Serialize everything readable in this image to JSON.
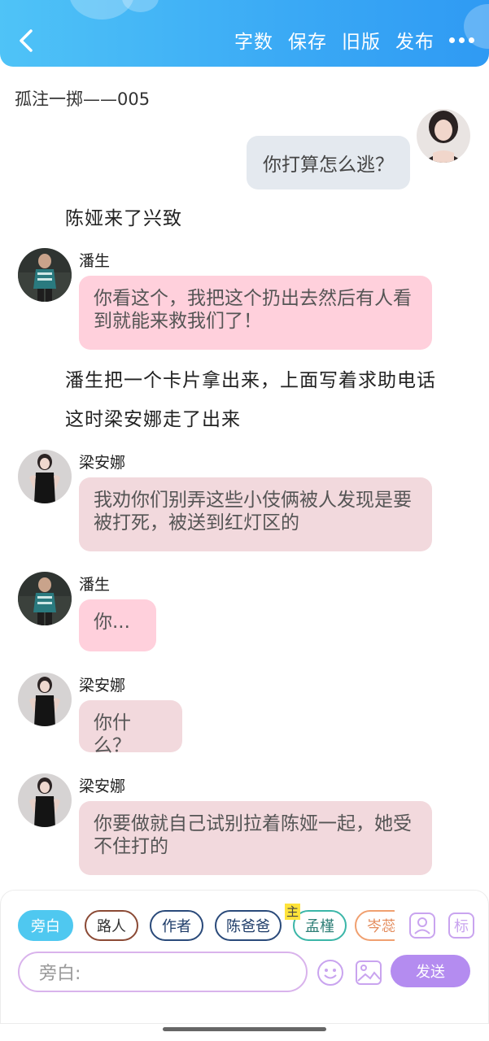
{
  "header": {
    "word_count_label": "字数",
    "save_label": "保存",
    "old_version_label": "旧版",
    "publish_label": "发布"
  },
  "story_title": "孤注一掷——005",
  "my_message": "你打算怎么逃？",
  "messages": [
    {
      "type": "narration",
      "text": "陈娅来了兴致"
    },
    {
      "type": "character",
      "speaker": "潘生",
      "text": "你看这个，我把这个扔出去然后有人看到就能来救我们了！"
    },
    {
      "type": "narration",
      "text": "潘生把一个卡片拿出来，上面写着求助电话"
    },
    {
      "type": "narration",
      "text": "这时梁安娜走了出来"
    },
    {
      "type": "character",
      "speaker": "梁安娜",
      "text": "我劝你们别弄这些小伎俩被人发现是要被打死，被送到红灯区的"
    },
    {
      "type": "character",
      "speaker": "潘生",
      "text": "你..."
    },
    {
      "type": "character",
      "speaker": "梁安娜",
      "text": "你什么？"
    },
    {
      "type": "character",
      "speaker": "梁安娜",
      "text": "你要做就自己试别拉着陈娅一起，她受不住打的"
    }
  ],
  "role_chips": [
    "旁白",
    "路人",
    "作者",
    "陈爸爸",
    "孟槿",
    "岑蕊"
  ],
  "main_badge": "主",
  "tool_icons": {
    "person": "person-card-icon",
    "mark": "mark-icon",
    "emoji": "emoji-icon",
    "image": "image-icon"
  },
  "mark_label": "标",
  "input": {
    "placeholder": "旁白:"
  },
  "send_label": "发送",
  "colors": {
    "header_start": "#4fc3f7",
    "header_end": "#2f9af3",
    "pink_bubble": "#ffd0dc",
    "rose_bubble": "#f2d9dd",
    "my_bubble": "#e4e9ef",
    "active_chip": "#4fc8f0",
    "send_button": "#b48cf0"
  }
}
